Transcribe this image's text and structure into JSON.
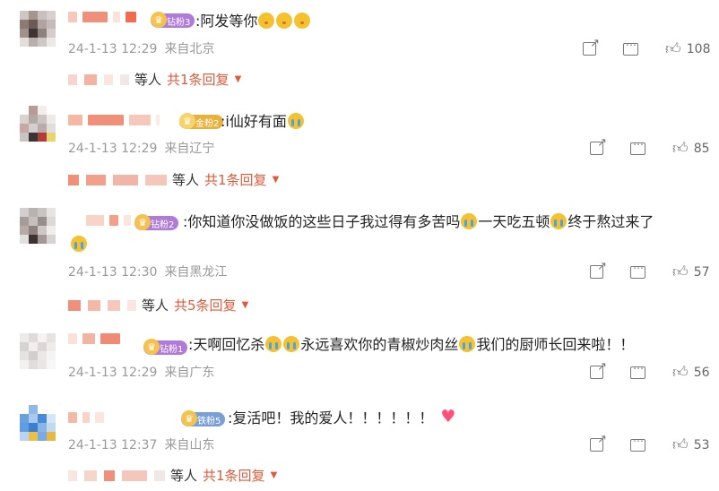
{
  "comments": [
    {
      "badge": "钻粉3",
      "badge_color": "#b07bd8",
      "text": ":阿发等你",
      "emojis": [
        "kiss",
        "kiss",
        "kiss"
      ],
      "time": "24-1-13 12:29",
      "location": "来自北京",
      "likes": "108",
      "reply_wait": "等人",
      "reply_count": "共1条回复"
    },
    {
      "badge": "金粉2",
      "badge_color": "#e8b13d",
      "text": ":i仙好有面",
      "emojis": [
        "cry"
      ],
      "time": "24-1-13 12:29",
      "location": "来自辽宁",
      "likes": "85",
      "reply_wait": "等人",
      "reply_count": "共1条回复"
    },
    {
      "badge": "钻粉2",
      "badge_color": "#b07bd8",
      "text_a": ":你知道你没做饭的这些日子我过得有多苦吗",
      "text_b": "一天吃五顿",
      "text_c": "终于熬过来了",
      "time": "24-1-13 12:30",
      "location": "来自黑龙江",
      "likes": "57",
      "reply_wait": "等人",
      "reply_count": "共5条回复"
    },
    {
      "badge": "钻粉1",
      "badge_color": "#b07bd8",
      "text_a": ":天啊回忆杀",
      "text_b": "永远喜欢你的青椒炒肉丝",
      "text_c": "我们的厨师长回来啦！！",
      "time": "24-1-13 12:29",
      "location": "来自广东",
      "likes": "56"
    },
    {
      "badge": "铁粉5",
      "badge_color": "#7a9fd6",
      "text": ":复活吧！我的爱人！！！！！！",
      "time": "24-1-13 12:37",
      "location": "来自山东",
      "likes": "53",
      "reply_wait": "等人",
      "reply_count": "共1条回复"
    }
  ],
  "colors": {
    "accent": "#e05a3a",
    "meta": "#999999"
  },
  "icons": [
    "share-icon",
    "reply-icon",
    "like-icon",
    "caret-down-icon"
  ]
}
